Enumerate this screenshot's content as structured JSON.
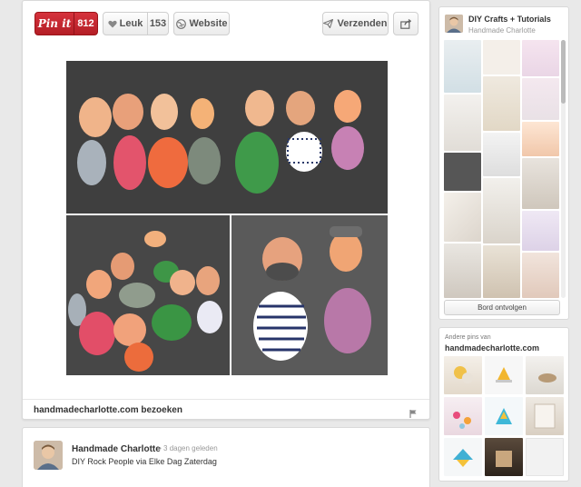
{
  "toolbar": {
    "pin_label": "Pin it",
    "pin_count": "812",
    "like_label": "Leuk",
    "like_count": "153",
    "website_label": "Website",
    "send_label": "Verzenden"
  },
  "source": {
    "link_text": "handmadecharlotte.com bezoeken"
  },
  "pinner": {
    "name": "Handmade Charlotte",
    "time": "• 3 dagen geleden",
    "description": "DIY Rock People via Elke Dag Zaterdag"
  },
  "board": {
    "title": "DIY Crafts + Tutorials",
    "owner": "Handmade Charlotte",
    "follow_label": "Bord ontvolgen"
  },
  "other_pins": {
    "label": "Andere pins van",
    "domain": "handmadecharlotte.com"
  },
  "colors": {
    "pin_red": "#c8232c",
    "page_bg": "#e9e9e9",
    "card_bg": "#ffffff"
  },
  "icons": {
    "heart": "heart-icon",
    "globe": "globe-icon",
    "send": "paper-plane-icon",
    "share": "share-icon",
    "flag": "flag-icon"
  }
}
